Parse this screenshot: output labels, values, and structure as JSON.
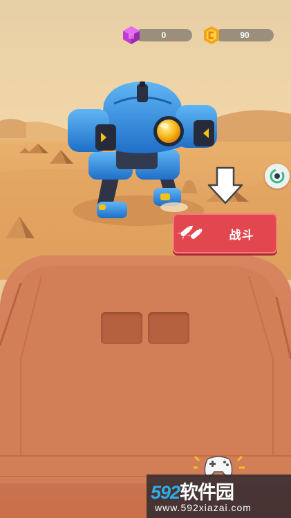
{
  "hud": {
    "gems_value": "0",
    "coins_value": "90"
  },
  "battle_button": {
    "label": "战斗"
  },
  "watermark": {
    "brand_number": "592",
    "brand_text": "软件园",
    "url": "www.592xiazai.com"
  },
  "colors": {
    "sky": "#f2d9ad",
    "sand": "#e5a865",
    "board": "#cf7d58",
    "button_red": "#e2464e",
    "robot_blue": "#2f8fe0"
  },
  "icons": [
    "gem-icon",
    "coin-icon",
    "down-arrow-icon",
    "rocket-icon",
    "side-shield-icon",
    "gamepad-icon"
  ]
}
